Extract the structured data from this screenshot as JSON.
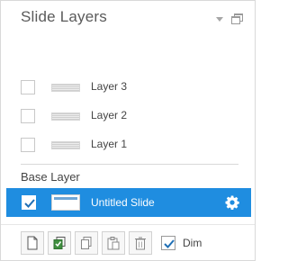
{
  "panel": {
    "title": "Slide Layers"
  },
  "layers": [
    {
      "label": "Layer 3",
      "checked": false
    },
    {
      "label": "Layer 2",
      "checked": false
    },
    {
      "label": "Layer 1",
      "checked": false
    }
  ],
  "base_layer": {
    "heading": "Base Layer",
    "slide_label": "Untitled Slide",
    "checked": true
  },
  "toolbar": {
    "buttons": [
      "new-layer-icon",
      "duplicate-layer-icon",
      "copy-icon",
      "paste-icon",
      "delete-icon"
    ],
    "dim_label": "Dim",
    "dim_checked": true
  },
  "colors": {
    "selection": "#1f8de0",
    "title": "#5a5a5a"
  }
}
